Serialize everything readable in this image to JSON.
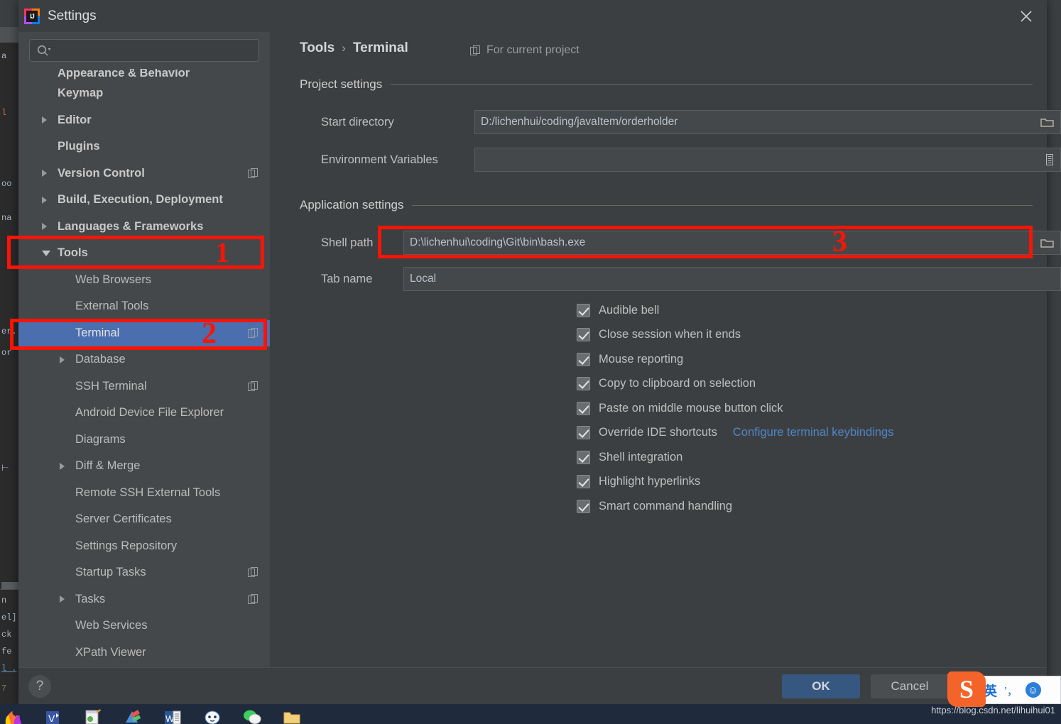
{
  "window": {
    "title": "Settings",
    "logo_text": "IJ",
    "close_icon": "close-icon"
  },
  "search": {
    "placeholder": "",
    "value": "",
    "icon": "search-icon"
  },
  "sidebar": {
    "items": [
      {
        "label": "Appearance & Behavior",
        "level": 0,
        "bold": true,
        "arrow": "",
        "badge": false,
        "selected": false,
        "clipped": true
      },
      {
        "label": "Keymap",
        "level": 0,
        "bold": true,
        "arrow": "",
        "badge": false,
        "selected": false
      },
      {
        "label": "Editor",
        "level": 0,
        "bold": true,
        "arrow": "right",
        "badge": false,
        "selected": false
      },
      {
        "label": "Plugins",
        "level": 0,
        "bold": true,
        "arrow": "",
        "badge": false,
        "selected": false
      },
      {
        "label": "Version Control",
        "level": 0,
        "bold": true,
        "arrow": "right",
        "badge": true,
        "selected": false
      },
      {
        "label": "Build, Execution, Deployment",
        "level": 0,
        "bold": true,
        "arrow": "right",
        "badge": false,
        "selected": false
      },
      {
        "label": "Languages & Frameworks",
        "level": 0,
        "bold": true,
        "arrow": "right",
        "badge": false,
        "selected": false
      },
      {
        "label": "Tools",
        "level": 0,
        "bold": true,
        "arrow": "down",
        "badge": false,
        "selected": false
      },
      {
        "label": "Web Browsers",
        "level": 1,
        "bold": false,
        "arrow": "",
        "badge": false,
        "selected": false
      },
      {
        "label": "External Tools",
        "level": 1,
        "bold": false,
        "arrow": "",
        "badge": false,
        "selected": false
      },
      {
        "label": "Terminal",
        "level": 1,
        "bold": false,
        "arrow": "",
        "badge": true,
        "selected": true
      },
      {
        "label": "Database",
        "level": 1,
        "bold": false,
        "arrow": "right",
        "badge": false,
        "selected": false
      },
      {
        "label": "SSH Terminal",
        "level": 1,
        "bold": false,
        "arrow": "",
        "badge": true,
        "selected": false
      },
      {
        "label": "Android Device File Explorer",
        "level": 1,
        "bold": false,
        "arrow": "",
        "badge": false,
        "selected": false
      },
      {
        "label": "Diagrams",
        "level": 1,
        "bold": false,
        "arrow": "",
        "badge": false,
        "selected": false
      },
      {
        "label": "Diff & Merge",
        "level": 1,
        "bold": false,
        "arrow": "right",
        "badge": false,
        "selected": false
      },
      {
        "label": "Remote SSH External Tools",
        "level": 1,
        "bold": false,
        "arrow": "",
        "badge": false,
        "selected": false
      },
      {
        "label": "Server Certificates",
        "level": 1,
        "bold": false,
        "arrow": "",
        "badge": false,
        "selected": false
      },
      {
        "label": "Settings Repository",
        "level": 1,
        "bold": false,
        "arrow": "",
        "badge": false,
        "selected": false
      },
      {
        "label": "Startup Tasks",
        "level": 1,
        "bold": false,
        "arrow": "",
        "badge": true,
        "selected": false
      },
      {
        "label": "Tasks",
        "level": 1,
        "bold": false,
        "arrow": "right",
        "badge": true,
        "selected": false
      },
      {
        "label": "Web Services",
        "level": 1,
        "bold": false,
        "arrow": "",
        "badge": false,
        "selected": false
      },
      {
        "label": "XPath Viewer",
        "level": 1,
        "bold": false,
        "arrow": "",
        "badge": false,
        "selected": false
      }
    ]
  },
  "main": {
    "breadcrumb": {
      "parent": "Tools",
      "separator": "›",
      "current": "Terminal"
    },
    "for_current_project": "For current project",
    "groups": {
      "project_settings": "Project settings",
      "application_settings": "Application settings"
    },
    "fields": {
      "start_directory": {
        "label": "Start directory",
        "value": "D:/lichenhui/coding/javaItem/orderholder",
        "icon": "folder-icon"
      },
      "environment_variables": {
        "label": "Environment Variables",
        "value": "",
        "icon": "list-icon"
      },
      "shell_path": {
        "label": "Shell path",
        "value": "D:\\lichenhui\\coding\\Git\\bin\\bash.exe",
        "icon": "folder-icon"
      },
      "tab_name": {
        "label": "Tab name",
        "value": "Local",
        "icon": ""
      }
    },
    "checkboxes": [
      {
        "label": "Audible bell",
        "checked": true
      },
      {
        "label": "Close session when it ends",
        "checked": true
      },
      {
        "label": "Mouse reporting",
        "checked": true
      },
      {
        "label": "Copy to clipboard on selection",
        "checked": true
      },
      {
        "label": "Paste on middle mouse button click",
        "checked": true
      },
      {
        "label": "Override IDE shortcuts",
        "checked": true,
        "link": "Configure terminal keybindings"
      },
      {
        "label": "Shell integration",
        "checked": true
      },
      {
        "label": "Highlight hyperlinks",
        "checked": true
      },
      {
        "label": "Smart command handling",
        "checked": true
      }
    ]
  },
  "footer": {
    "help_label": "?",
    "ok_label": "OK",
    "cancel_label": "Cancel"
  },
  "annotations": [
    {
      "id": "anno-1",
      "text": "1"
    },
    {
      "id": "anno-2",
      "text": "2"
    },
    {
      "id": "anno-3",
      "text": "3"
    }
  ],
  "taskbar": {
    "watermark": "https://blog.csdn.net/lihuihui01"
  },
  "ime": {
    "logo": "S",
    "mode": "英",
    "punct": "’，",
    "face": "☺"
  },
  "colors": {
    "accent_selection": "#4b6eaf",
    "ok_button": "#365880",
    "link": "#4e86c7",
    "annotation_red": "#fb1405",
    "dialog_bg": "#3c3f41",
    "sidebar_bg": "#45484a"
  },
  "background_code": {
    "lines": [
      "a",
      "l",
      "oo",
      "na",
      "er.",
      "or",
      "n",
      "el",
      "ck",
      "fe",
      "l .",
      "7"
    ]
  }
}
